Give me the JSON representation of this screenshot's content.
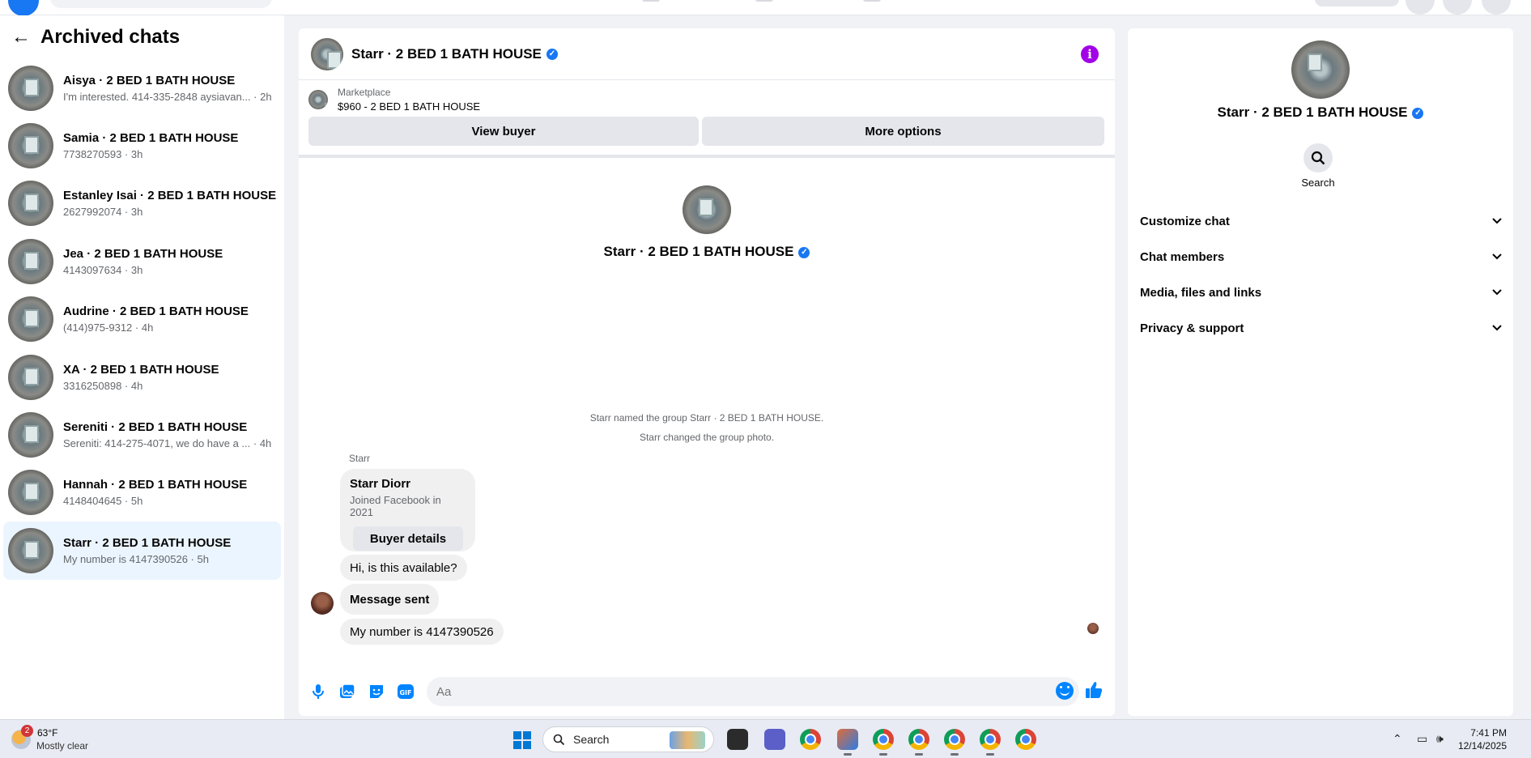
{
  "sidebar": {
    "title": "Archived chats",
    "chats": [
      {
        "name": "Aisya · 2 BED 1 BATH HOUSE",
        "preview": "I'm interested. 414-335-2848 aysiavan... · 2h"
      },
      {
        "name": "Samia · 2 BED 1 BATH HOUSE",
        "preview": "7738270593 · 3h"
      },
      {
        "name": "Estanley Isai · 2 BED 1 BATH HOUSE",
        "preview": "2627992074 · 3h"
      },
      {
        "name": "Jea · 2 BED 1 BATH HOUSE",
        "preview": "4143097634 · 3h"
      },
      {
        "name": "Audrine · 2 BED 1 BATH HOUSE",
        "preview": "(414)975-9312 · 4h"
      },
      {
        "name": "XA · 2 BED 1 BATH HOUSE",
        "preview": "3316250898 · 4h"
      },
      {
        "name": "Sereniti · 2 BED 1 BATH HOUSE",
        "preview": "Sereniti: 414-275-4071, we do have a ... · 4h"
      },
      {
        "name": "Hannah · 2 BED 1 BATH HOUSE",
        "preview": "4148404645 · 5h"
      },
      {
        "name": "Starr · 2 BED 1 BATH HOUSE",
        "preview": "My number is 4147390526 · 5h"
      }
    ]
  },
  "conversation": {
    "title": "Starr · 2 BED 1 BATH HOUSE",
    "marketplace_label": "Marketplace",
    "listing": "$960 - 2 BED 1 BATH HOUSE",
    "view_buyer_label": "View buyer",
    "more_options_label": "More options",
    "system_messages": [
      "Starr named the group Starr · 2 BED 1 BATH HOUSE.",
      "Starr changed the group photo."
    ],
    "sender": "Starr",
    "card": {
      "name": "Starr Diorr",
      "sub": "Joined Facebook in 2021",
      "button": "Buyer details"
    },
    "messages": [
      "Hi, is this available?",
      "Message sent",
      "My number is 4147390526"
    ],
    "composer_placeholder": "Aa"
  },
  "details": {
    "name": "Starr · 2 BED 1 BATH HOUSE",
    "search_label": "Search",
    "sections": [
      "Customize chat",
      "Chat members",
      "Media, files and links",
      "Privacy & support"
    ]
  },
  "taskbar": {
    "weather_badge": "2",
    "temperature": "63°F",
    "weather_desc": "Mostly clear",
    "search_label": "Search",
    "time": "7:41 PM",
    "date": "12/14/2025"
  },
  "colors": {
    "accent": "#1877f2",
    "active_chat": "#ebf5ff",
    "info_button": "#a200e6"
  }
}
